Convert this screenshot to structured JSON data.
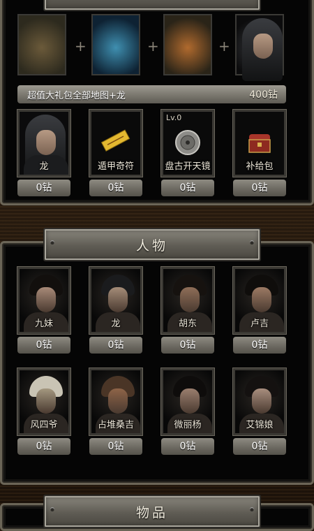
{
  "sections": {
    "top_title": "",
    "characters_title": "人物",
    "items_title": "物品"
  },
  "bundle": {
    "label": "超值大礼包全部地图+龙",
    "price": "400钻"
  },
  "plus_sign": "+",
  "maps": [
    {
      "icon": "ruined-city-map-icon",
      "colors": [
        "#6b5a3a",
        "#2d2a1e"
      ]
    },
    {
      "icon": "underground-lake-map-icon",
      "colors": [
        "#3f8fb0",
        "#0e2233"
      ]
    },
    {
      "icon": "jungle-temple-map-icon",
      "colors": [
        "#b06a2e",
        "#2a2418"
      ]
    },
    {
      "icon": "hooded-dragon-portrait-icon",
      "colors": [
        "#3a3c40",
        "#0c0c0d"
      ]
    }
  ],
  "shop_items": [
    {
      "name": "龙",
      "price": "0钻",
      "icon": "hooded-man-portrait-icon"
    },
    {
      "name": "遁甲奇符",
      "price": "0钻",
      "icon": "talisman-icon"
    },
    {
      "name": "盘古开天镜",
      "price": "0钻",
      "icon": "bronze-mirror-icon",
      "level": "Lv.0"
    },
    {
      "name": "补给包",
      "price": "0钻",
      "icon": "treasure-chest-icon"
    }
  ],
  "characters": [
    {
      "name": "九妹",
      "price": "0钻",
      "icon": "jiumei-portrait-icon",
      "skin": "#a88a78",
      "hair": "#120f0d"
    },
    {
      "name": "龙",
      "price": "0钻",
      "icon": "long-portrait-icon",
      "skin": "#a48c78",
      "hair": "#1a1b1d"
    },
    {
      "name": "胡东",
      "price": "0钻",
      "icon": "hudong-portrait-icon",
      "skin": "#8f6e58",
      "hair": "#16120f"
    },
    {
      "name": "卢吉",
      "price": "0钻",
      "icon": "luji-portrait-icon",
      "skin": "#9c7a64",
      "hair": "#0f0d0b"
    },
    {
      "name": "风四爷",
      "price": "0钻",
      "icon": "fengsiye-portrait-icon",
      "skin": "#a49880",
      "hair": "#c9c4b4"
    },
    {
      "name": "占堆桑吉",
      "price": "0钻",
      "icon": "zhandui-portrait-icon",
      "skin": "#8e6448",
      "hair": "#4a3526"
    },
    {
      "name": "微丽杨",
      "price": "0钻",
      "icon": "weiliyang-portrait-icon",
      "skin": "#9a7e6e",
      "hair": "#0e0c0b"
    },
    {
      "name": "艾锦娘",
      "price": "0钻",
      "icon": "aijinniang-portrait-icon",
      "skin": "#a88e7e",
      "hair": "#141110"
    }
  ]
}
